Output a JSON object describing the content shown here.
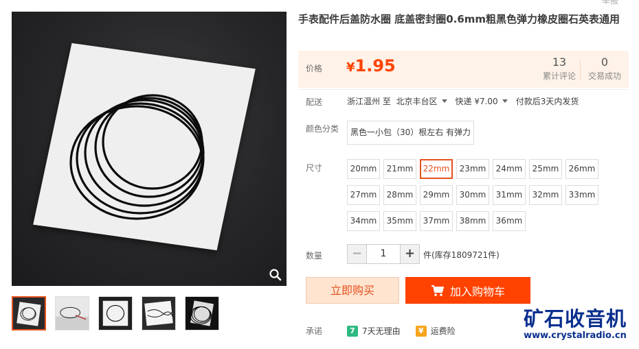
{
  "top_link": "举报",
  "product": {
    "title": "手表配件后盖防水圈 底盖密封圈0.6mm粗黑色弹力橡皮圈石英表通用",
    "price_label": "价格",
    "price_symbol": "¥",
    "price": "1.95",
    "review_count": "13",
    "review_label": "累计评论",
    "deal_count": "0",
    "deal_label": "交易成功"
  },
  "shipping": {
    "label": "配送",
    "from": "浙江温州",
    "to_word": "至",
    "destination": "北京丰台区",
    "method": "快递 ¥7.00",
    "eta": "付款后3天内发货"
  },
  "color": {
    "label": "颜色分类",
    "options": [
      "黑色一小包（30）根左右 有弹力"
    ]
  },
  "size": {
    "label": "尺寸",
    "selected": "22mm",
    "options": [
      "20mm",
      "21mm",
      "22mm",
      "23mm",
      "24mm",
      "25mm",
      "26mm",
      "27mm",
      "28mm",
      "29mm",
      "30mm",
      "31mm",
      "32mm",
      "33mm",
      "34mm",
      "35mm",
      "37mm",
      "38mm",
      "36mm"
    ]
  },
  "quantity": {
    "label": "数量",
    "minus": "−",
    "value": "1",
    "plus": "+",
    "stock": "件(库存1809721件)"
  },
  "actions": {
    "buy_now": "立即购买",
    "add_to_cart": "加入购物车"
  },
  "promise": {
    "label": "承诺",
    "return_badge": "7",
    "return_text": "7天无理由",
    "insurance_text": "运费险"
  },
  "watermark": {
    "name": "矿石收音机",
    "url": "www.crystalradio.cn"
  },
  "colors": {
    "accent": "#ff4200",
    "price": "#ff4400",
    "price_bg": "#fff2e8",
    "selected_border": "#e5511d"
  }
}
